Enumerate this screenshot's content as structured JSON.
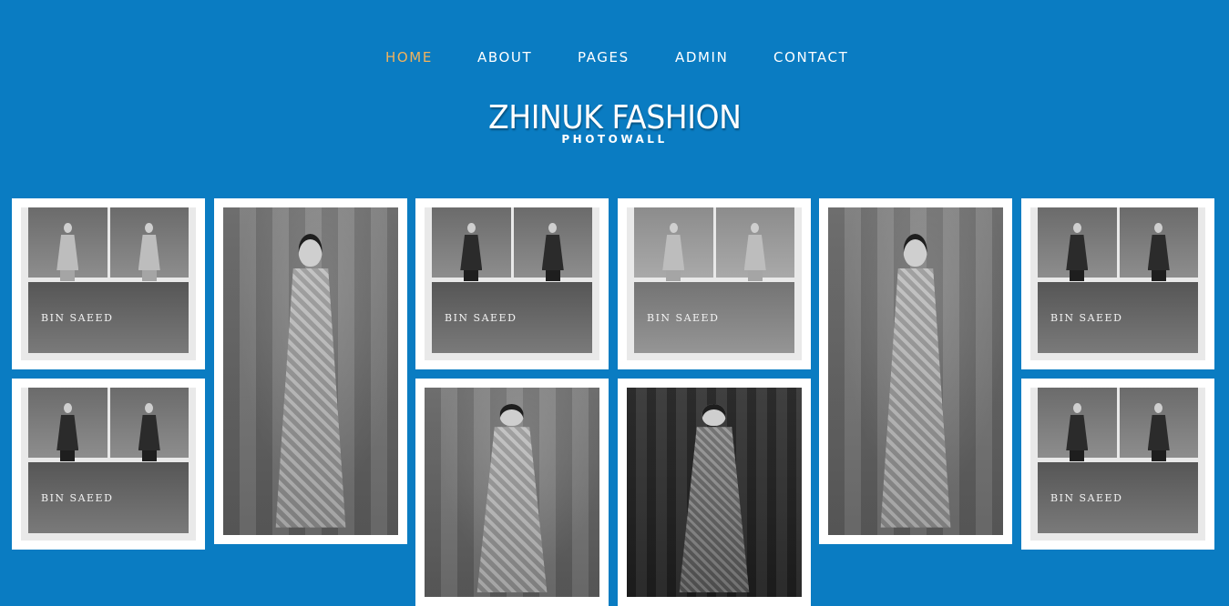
{
  "nav": {
    "items": [
      {
        "label": "HOME",
        "active": true
      },
      {
        "label": "ABOUT",
        "active": false
      },
      {
        "label": "PAGES",
        "active": false
      },
      {
        "label": "ADMIN",
        "active": false
      },
      {
        "label": "CONTACT",
        "active": false
      }
    ],
    "active_color": "#f2b25c",
    "text_color": "#ffffff"
  },
  "brand": {
    "title": "ZHINUK FASHION",
    "subtitle": "PHOTOWALL"
  },
  "theme": {
    "background": "#0a7cc2",
    "tile_border": "#ffffff"
  },
  "gallery": {
    "collage_label": "BIN SAEED"
  }
}
